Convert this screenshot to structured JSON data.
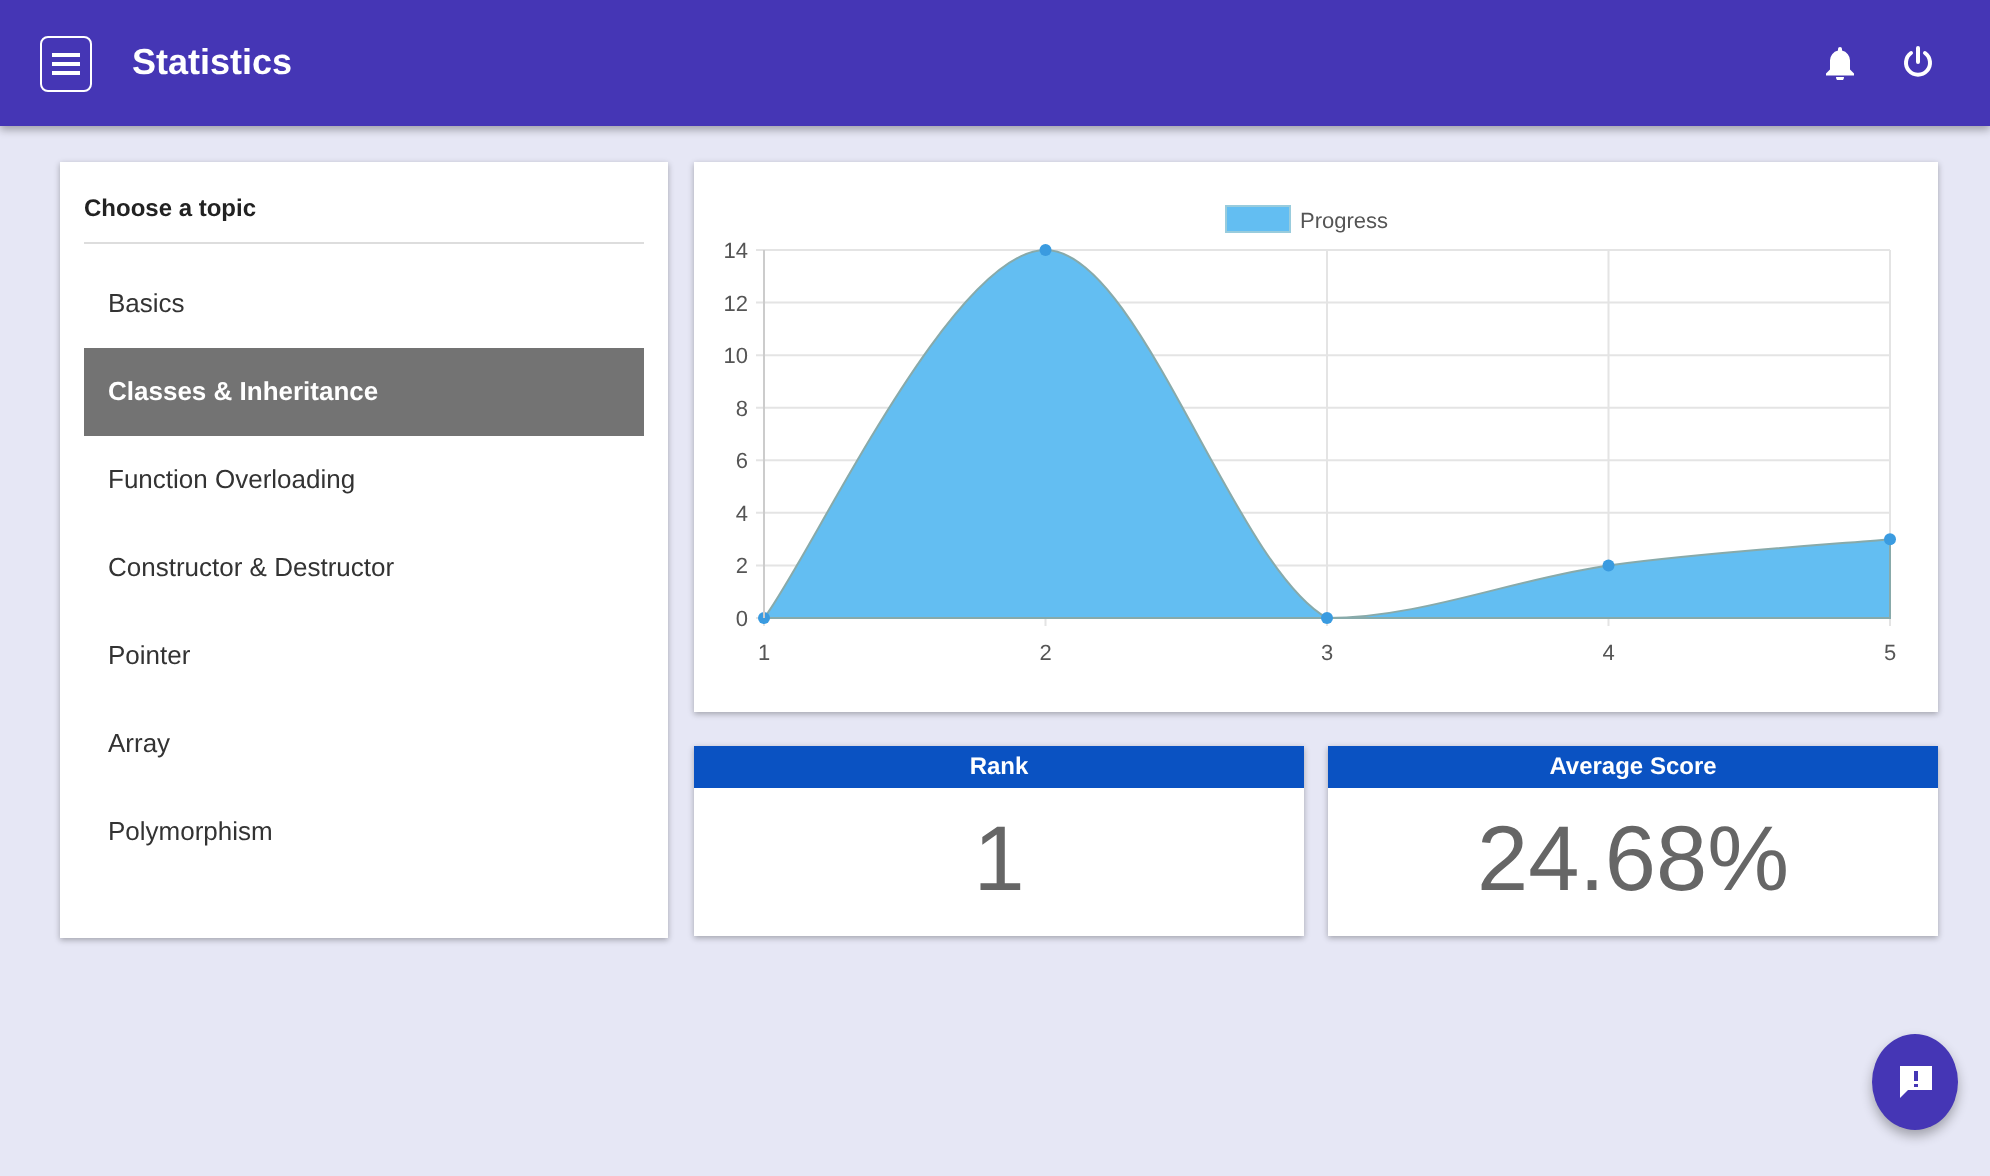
{
  "header": {
    "title": "Statistics"
  },
  "topics": {
    "title": "Choose a topic",
    "items": [
      {
        "label": "Basics",
        "selected": false
      },
      {
        "label": "Classes & Inheritance",
        "selected": true
      },
      {
        "label": "Function Overloading",
        "selected": false
      },
      {
        "label": "Constructor & Destructor",
        "selected": false
      },
      {
        "label": "Pointer",
        "selected": false
      },
      {
        "label": "Array",
        "selected": false
      },
      {
        "label": "Polymorphism",
        "selected": false
      }
    ]
  },
  "progress_chart": {
    "chart_data": {
      "type": "area",
      "categories": [
        "1",
        "2",
        "3",
        "4",
        "5"
      ],
      "series": [
        {
          "name": "Progress",
          "color": "#63bef2",
          "values": [
            0,
            14,
            0,
            2,
            3
          ]
        }
      ],
      "ylim": [
        0,
        14
      ],
      "grid": true,
      "yticks": [
        0,
        2,
        4,
        6,
        8,
        10,
        12,
        14
      ]
    }
  },
  "stats": [
    {
      "label": "Rank",
      "value": "1"
    },
    {
      "label": "Average Score",
      "value": "24.68%"
    }
  ]
}
